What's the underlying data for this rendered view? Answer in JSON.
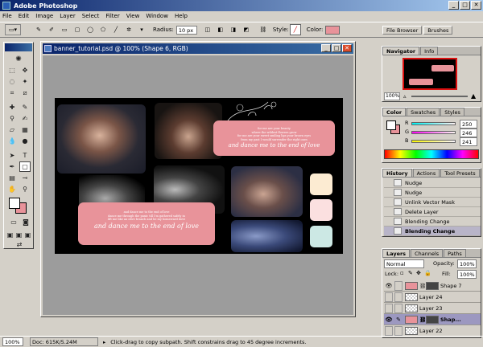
{
  "app": {
    "title": "Adobe Photoshop"
  },
  "menu": [
    "File",
    "Edit",
    "Image",
    "Layer",
    "Select",
    "Filter",
    "View",
    "Window",
    "Help"
  ],
  "options": {
    "radius_label": "Radius:",
    "radius_value": "10 px",
    "style_label": "Style:",
    "color_label": "Color:",
    "color_value": "#e8939a"
  },
  "wells": [
    "File Browser",
    "Brushes"
  ],
  "document": {
    "title": "banner_tutorial.psd @ 100% (Shape 6, RGB)",
    "lyric_top": [
      "for me are your beauty",
      "where the wildest flowers grow",
      "for me are your sweet smiling lips your brown eyes",
      "from my past I would surrender the right ones"
    ],
    "lyric_top_big": "and dance me to the end of love",
    "lyric_bottom": [
      "and dance me to the end of love",
      "dance me through the panic till I'm gathered safely in",
      "lift me like an olive branch and be my homeward dove"
    ],
    "lyric_bottom_big": "and dance me to the end of love",
    "swatches": [
      "#fcebd2",
      "#fbe0e0",
      "#cce8e4"
    ]
  },
  "navigator": {
    "tabs": [
      "Navigator",
      "Info"
    ],
    "zoom": "100%"
  },
  "color_panel": {
    "tabs": [
      "Color",
      "Swatches",
      "Styles"
    ],
    "r_label": "R",
    "g_label": "G",
    "b_label": "B",
    "r": "250",
    "g": "246",
    "b": "241"
  },
  "history": {
    "tabs": [
      "History",
      "Actions",
      "Tool Presets"
    ],
    "items": [
      "Nudge",
      "Nudge",
      "Unlink Vector Mask",
      "Delete Layer",
      "Blending Change",
      "Blending Change"
    ]
  },
  "layers": {
    "tabs": [
      "Layers",
      "Channels",
      "Paths"
    ],
    "blend_mode": "Normal",
    "opacity_label": "Opacity:",
    "opacity": "100%",
    "lock_label": "Lock:",
    "fill_label": "Fill:",
    "fill": "100%",
    "items": [
      "Shape 7",
      "Layer 24",
      "Layer 23",
      "Shap...",
      "Layer 22"
    ]
  },
  "status": {
    "zoom": "100%",
    "doc": "Doc: 615K/5.24M",
    "hint": "Click-drag to copy subpath. Shift constrains drag to 45 degree increments."
  }
}
